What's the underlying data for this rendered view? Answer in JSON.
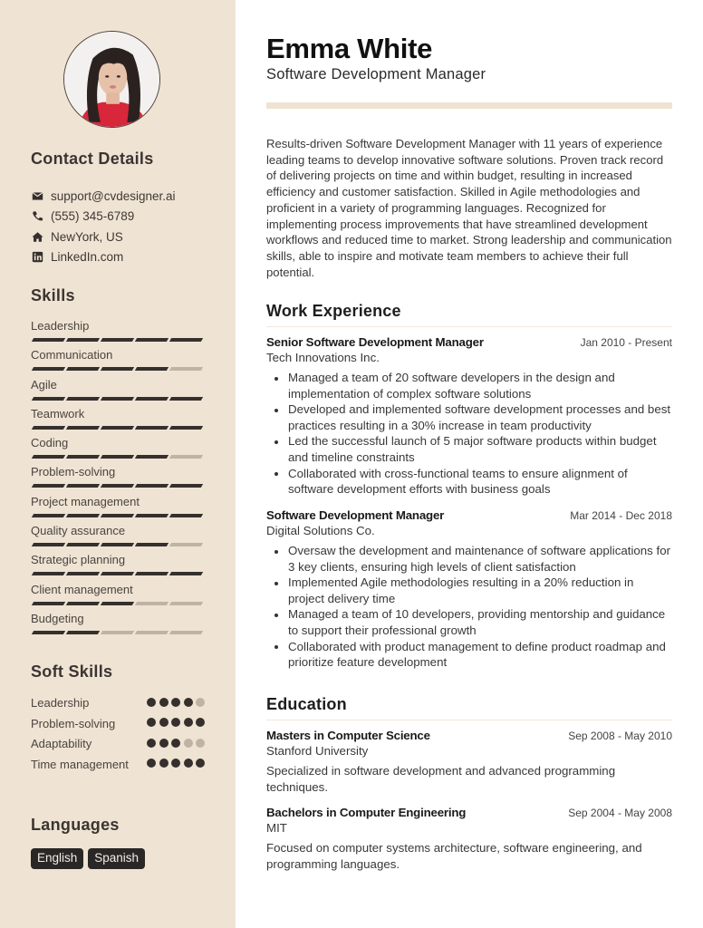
{
  "profile": {
    "name": "Emma White",
    "title": "Software Development Manager",
    "photo_alt": "profile-photo"
  },
  "colors": {
    "sidebar_bg": "#efe3d3",
    "accent_dark": "#35302d",
    "accent_muted": "#bfb3a5",
    "badge_bg": "#2a2826"
  },
  "contact": {
    "heading": "Contact Details",
    "items": [
      {
        "icon": "envelope-icon",
        "text": "support@cvdesigner.ai"
      },
      {
        "icon": "phone-icon",
        "text": "(555) 345-6789"
      },
      {
        "icon": "home-icon",
        "text": "NewYork, US"
      },
      {
        "icon": "linkedin-icon",
        "text": "LinkedIn.com"
      }
    ]
  },
  "skills": {
    "heading": "Skills",
    "max": 5,
    "items": [
      {
        "label": "Leadership",
        "level": 5
      },
      {
        "label": "Communication",
        "level": 4
      },
      {
        "label": "Agile",
        "level": 5
      },
      {
        "label": "Teamwork",
        "level": 5
      },
      {
        "label": "Coding",
        "level": 4
      },
      {
        "label": "Problem-solving",
        "level": 5
      },
      {
        "label": "Project management",
        "level": 5
      },
      {
        "label": "Quality assurance",
        "level": 4
      },
      {
        "label": "Strategic planning",
        "level": 5
      },
      {
        "label": "Client management",
        "level": 3
      },
      {
        "label": "Budgeting",
        "level": 2
      }
    ]
  },
  "soft_skills": {
    "heading": "Soft Skills",
    "max": 5,
    "items": [
      {
        "label": "Leadership",
        "level": 4
      },
      {
        "label": "Problem-solving",
        "level": 5
      },
      {
        "label": "Adaptability",
        "level": 3
      },
      {
        "label": "Time management",
        "level": 5
      }
    ]
  },
  "languages": {
    "heading": "Languages",
    "items": [
      "English",
      "Spanish"
    ]
  },
  "summary": "Results-driven Software Development Manager with 11 years of experience leading teams to develop innovative software solutions. Proven track record of delivering projects on time and within budget, resulting in increased efficiency and customer satisfaction. Skilled in Agile methodologies and proficient in a variety of programming languages. Recognized for implementing process improvements that have streamlined development workflows and reduced time to market. Strong leadership and communication skills, able to inspire and motivate team members to achieve their full potential.",
  "work": {
    "heading": "Work Experience",
    "entries": [
      {
        "role": "Senior Software Development Manager",
        "date": "Jan 2010 - Present",
        "org": "Tech Innovations Inc.",
        "bullets": [
          "Managed a team of 20 software developers in the design and implementation of complex software solutions",
          "Developed and implemented software development processes and best practices resulting in a 30% increase in team productivity",
          "Led the successful launch of 5 major software products within budget and timeline constraints",
          "Collaborated with cross-functional teams to ensure alignment of software development efforts with business goals"
        ]
      },
      {
        "role": "Software Development Manager",
        "date": "Mar 2014 - Dec 2018",
        "org": "Digital Solutions Co.",
        "bullets": [
          "Oversaw the development and maintenance of software applications for 3 key clients, ensuring high levels of client satisfaction",
          "Implemented Agile methodologies resulting in a 20% reduction in project delivery time",
          "Managed a team of 10 developers, providing mentorship and guidance to support their professional growth",
          "Collaborated with product management to define product roadmap and prioritize feature development"
        ]
      }
    ]
  },
  "education": {
    "heading": "Education",
    "entries": [
      {
        "degree": "Masters in Computer Science",
        "date": "Sep 2008 - May 2010",
        "school": "Stanford University",
        "desc": "Specialized in software development and advanced programming techniques."
      },
      {
        "degree": "Bachelors in Computer Engineering",
        "date": "Sep 2004 - May 2008",
        "school": "MIT",
        "desc": "Focused on computer systems architecture, software engineering, and programming languages."
      }
    ]
  }
}
